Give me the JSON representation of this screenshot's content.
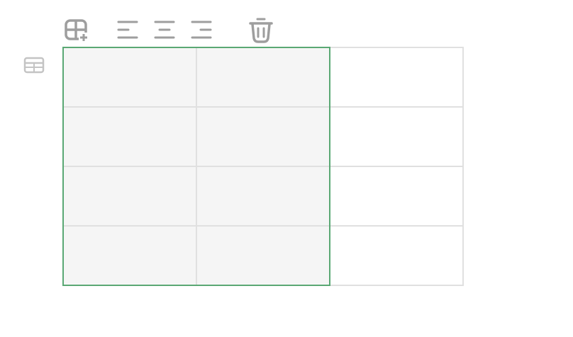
{
  "toolbar": {
    "items": [
      {
        "icon": "insert-cell-icon"
      },
      {
        "icon": "align-left-icon"
      },
      {
        "icon": "align-center-icon"
      },
      {
        "icon": "align-right-icon"
      },
      {
        "icon": "trash-icon"
      }
    ]
  },
  "table": {
    "rows": 4,
    "columns": 3,
    "selected_columns": [
      1,
      2
    ],
    "cells": [
      [
        "",
        "",
        ""
      ],
      [
        "",
        "",
        ""
      ],
      [
        "",
        "",
        ""
      ],
      [
        "",
        "",
        ""
      ]
    ]
  },
  "colors": {
    "icon": "#9e9e9e",
    "grid_line": "#e0e0e0",
    "selection_border": "#5aa874",
    "selection_fill": "#f5f5f5"
  }
}
